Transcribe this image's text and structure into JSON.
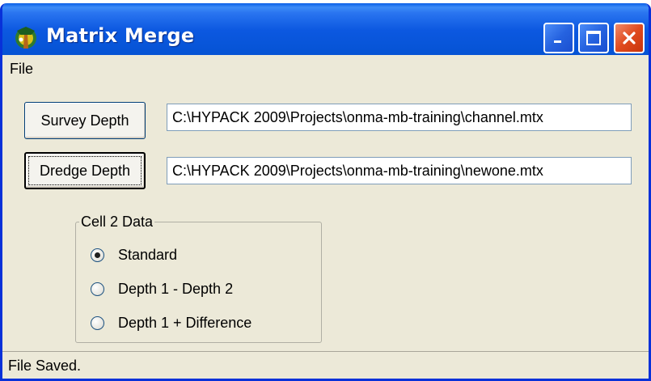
{
  "window": {
    "title": "Matrix Merge",
    "icon": "hypack-app-icon",
    "controls": [
      "minimize-icon",
      "maximize-icon",
      "close-icon"
    ]
  },
  "menu": {
    "file_label": "File"
  },
  "survey": {
    "button_label": "Survey Depth",
    "path": "C:\\HYPACK 2009\\Projects\\onma-mb-training\\channel.mtx"
  },
  "dredge": {
    "button_label": "Dredge Depth",
    "path": "C:\\HYPACK 2009\\Projects\\onma-mb-training\\newone.mtx"
  },
  "cell_data": {
    "title": "Cell 2 Data",
    "options": [
      {
        "label": "Standard",
        "selected": true
      },
      {
        "label": "Depth 1 - Depth 2",
        "selected": false
      },
      {
        "label": "Depth 1 + Difference",
        "selected": false
      }
    ]
  },
  "status": {
    "text": "File Saved."
  },
  "colors": {
    "title_bar": "#0654d6",
    "close_button": "#e04a1e",
    "window_bg": "#ece9d8"
  }
}
